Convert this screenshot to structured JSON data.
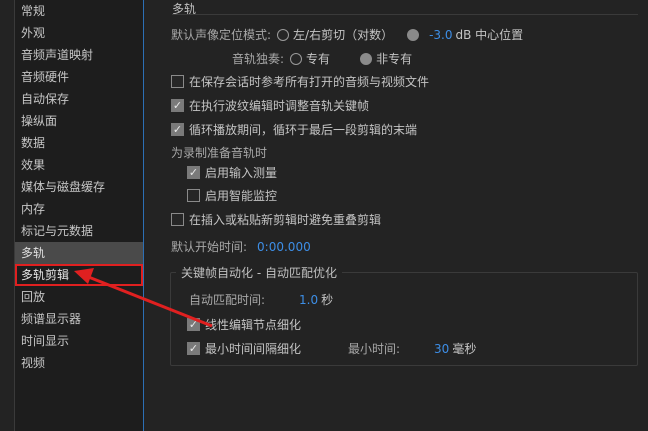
{
  "sidebar": {
    "items": [
      {
        "label": "常规"
      },
      {
        "label": "外观"
      },
      {
        "label": "音频声道映射"
      },
      {
        "label": "音频硬件"
      },
      {
        "label": "自动保存"
      },
      {
        "label": "操纵面"
      },
      {
        "label": "数据"
      },
      {
        "label": "效果"
      },
      {
        "label": "媒体与磁盘缓存"
      },
      {
        "label": "内存"
      },
      {
        "label": "标记与元数据"
      },
      {
        "label": "多轨"
      },
      {
        "label": "多轨剪辑"
      },
      {
        "label": "回放"
      },
      {
        "label": "频谱显示器"
      },
      {
        "label": "时间显示"
      },
      {
        "label": "视频"
      }
    ],
    "selected_index": 11,
    "highlighted_index": 12
  },
  "main": {
    "section_title": "多轨",
    "pan_mode": {
      "label": "默认声像定位模式:",
      "option_a": "左/右剪切（对数）",
      "option_b_value": "-3.0",
      "option_b_suffix": "dB 中心位置"
    },
    "solo": {
      "label": "音轨独奏:",
      "option_a": "专有",
      "option_b": "非专有"
    },
    "checkboxes": [
      {
        "label": "在保存会话时参考所有打开的音频与视频文件",
        "checked": false
      },
      {
        "label": "在执行波纹编辑时调整音轨关键帧",
        "checked": true
      },
      {
        "label": "循环播放期间，循环于最后一段剪辑的末端",
        "checked": true
      }
    ],
    "record_prep": {
      "label": "为录制准备音轨时",
      "options": [
        {
          "label": "启用输入测量",
          "checked": true
        },
        {
          "label": "启用智能监控",
          "checked": false
        }
      ]
    },
    "avoid_overlap": {
      "label": "在插入或粘贴新剪辑时避免重叠剪辑",
      "checked": false
    },
    "default_start": {
      "label": "默认开始时间:",
      "value": "0:00.000"
    },
    "automation": {
      "title": "关键帧自动化 - 自动匹配优化",
      "match_time_label": "自动匹配时间:",
      "match_time_value": "1.0",
      "match_time_unit": "秒",
      "linear_edit": {
        "label": "线性编辑节点细化",
        "checked": true
      },
      "min_interval": {
        "label": "最小时间间隔细化",
        "checked": true
      },
      "min_time_label": "最小时间:",
      "min_time_value": "30",
      "min_time_unit": "毫秒"
    }
  },
  "colors": {
    "accent": "#3d8ee6",
    "highlight": "#e02020"
  }
}
